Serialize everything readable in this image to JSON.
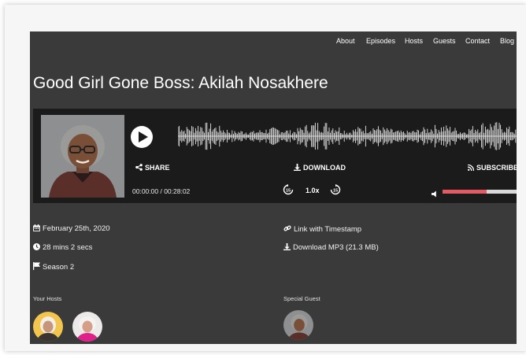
{
  "nav": {
    "items": [
      "About",
      "Episodes",
      "Hosts",
      "Guests",
      "Contact",
      "Blog"
    ]
  },
  "episode": {
    "title": "Good Girl Gone Boss: Akilah Nosakhere"
  },
  "player": {
    "share_label": "SHARE",
    "download_label": "DOWNLOAD",
    "subscribe_label": "SUBSCRIBE",
    "current_time": "00:00:00",
    "separator": " / ",
    "duration": "00:28:02",
    "speed": "1.0x",
    "skip_back_seconds": "15",
    "skip_forward_seconds": "15",
    "volume_level": 0.6,
    "accent_color": "#e35a63"
  },
  "details": {
    "date": "February 25th, 2020",
    "length": "28 mins 2 secs",
    "season": "Season 2",
    "link_timestamp": "Link with Timestamp",
    "download_mp3": "Download MP3 (21.3 MB)"
  },
  "people": {
    "hosts_label": "Your Hosts",
    "guest_label": "Special Guest"
  },
  "icons": [
    "play-icon",
    "share-icon",
    "download-icon",
    "rss-icon",
    "rewind-15-icon",
    "forward-15-icon",
    "volume-icon",
    "calendar-icon",
    "clock-icon",
    "flag-icon",
    "link-icon",
    "download-icon"
  ]
}
